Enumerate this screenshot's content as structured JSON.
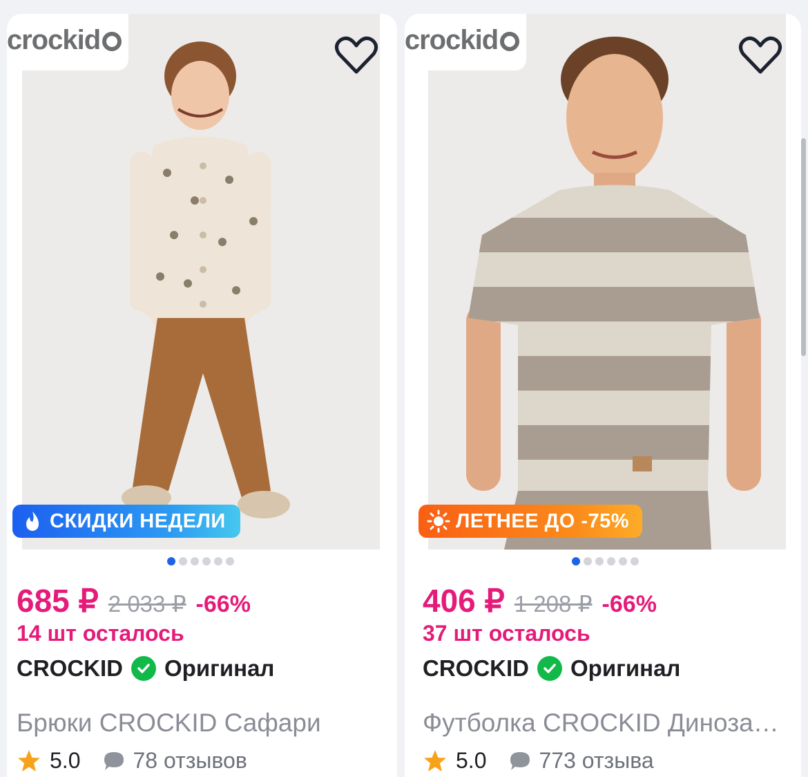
{
  "products": [
    {
      "brand_logo": "crockid",
      "badge": "СКИДКИ НЕДЕЛИ",
      "badge_icon": "flame-icon",
      "price": "685 ₽",
      "old_price": "2 033 ₽",
      "discount": "-66%",
      "stock": "14 шт осталось",
      "brand": "CROCKID",
      "original_label": "Оригинал",
      "title": "Брюки CROCKID Сафари",
      "rating": "5.0",
      "reviews": "78 отзывов",
      "image_slides": 6,
      "active_slide": 1
    },
    {
      "brand_logo": "crockid",
      "badge": "ЛЕТНЕЕ ДО -75%",
      "badge_icon": "sun-icon",
      "price": "406 ₽",
      "old_price": "1 208 ₽",
      "discount": "-66%",
      "stock": "37 шт осталось",
      "brand": "CROCKID",
      "original_label": "Оригинал",
      "title": "Футболка CROCKID Динозавры",
      "rating": "5.0",
      "reviews": "773 отзыва",
      "image_slides": 6,
      "active_slide": 1
    }
  ],
  "colors": {
    "price": "#e51b7a",
    "accent_blue": "#1e63e6",
    "verified_green": "#11b94a",
    "star": "#f7a21b"
  }
}
